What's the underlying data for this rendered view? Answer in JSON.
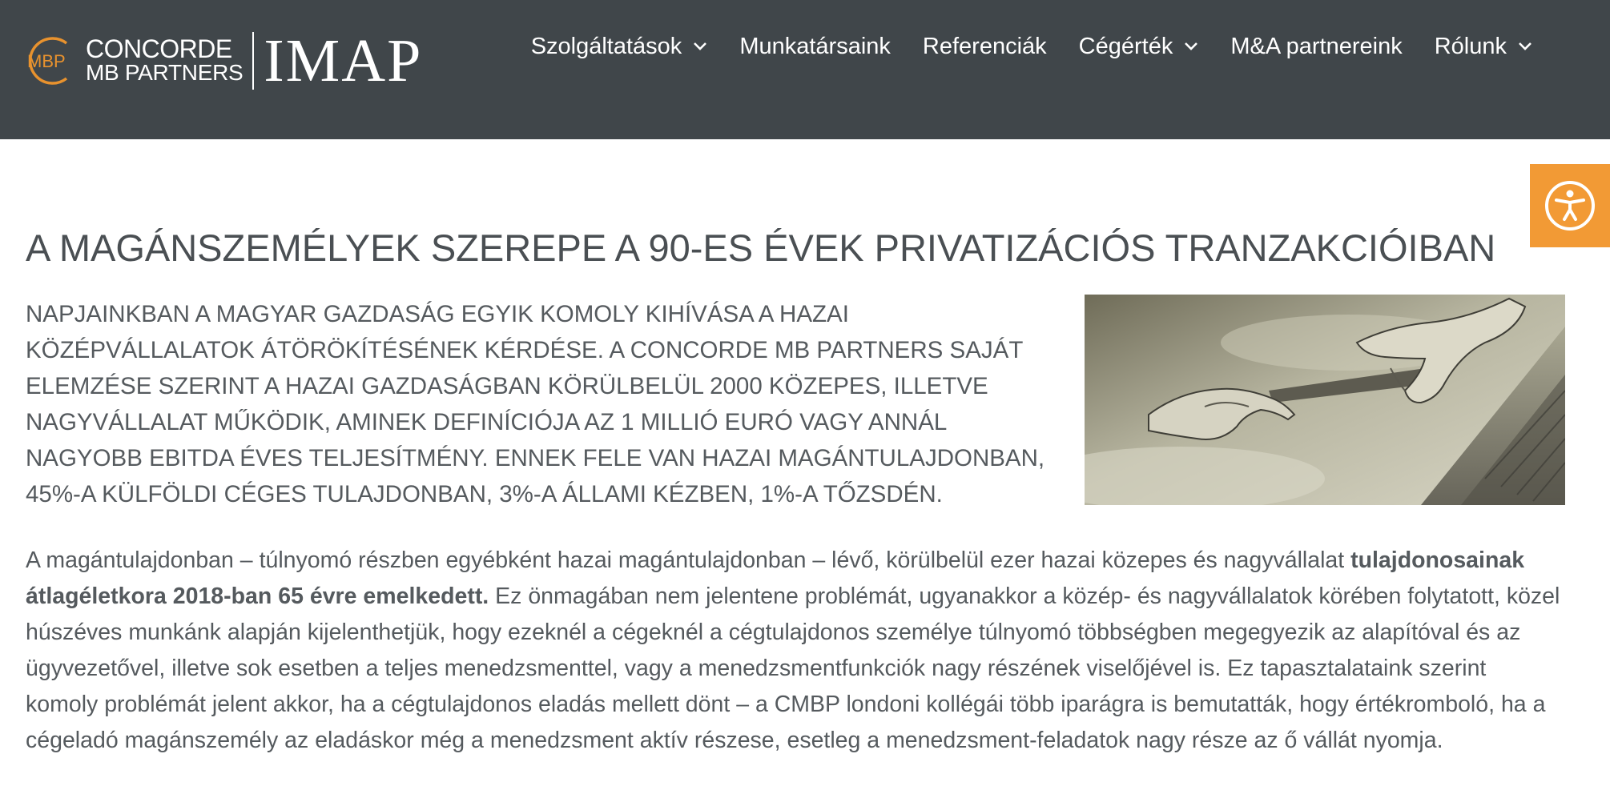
{
  "brand": {
    "mark": "MBP",
    "line1": "CONCORDE",
    "line2": "MB PARTNERS",
    "imap": "IMAP",
    "accent": "#e8922e"
  },
  "nav": {
    "items": [
      {
        "label": "Szolgáltatások",
        "has_dropdown": true
      },
      {
        "label": "Munkatársaink",
        "has_dropdown": false
      },
      {
        "label": "Referenciák",
        "has_dropdown": false
      },
      {
        "label": "Cégérték",
        "has_dropdown": true
      },
      {
        "label": "M&A partnereink",
        "has_dropdown": false
      },
      {
        "label": "Rólunk",
        "has_dropdown": true
      }
    ]
  },
  "accessibility": {
    "icon": "accessibility-icon",
    "color": "#f29a35"
  },
  "article": {
    "title": "A MAGÁNSZEMÉLYEK SZEREPE A 90-ES ÉVEK PRIVATIZÁCIÓS TRANZAKCIÓIBAN",
    "lead": "Napjainkban a magyar gazdaság egyik komoly kihívása a hazai középvállalatok átörökítésének kérdése. A Concorde MB Partners saját elemzése szerint a hazai gazdaságban körülbelül 2000 közepes, illetve nagyvállalat működik, aminek definíciója az 1 millió euró vagy annál nagyobb EBITDA éves teljesítmény. Ennek fele van hazai magántulajdonban, 45%-a külföldi céges tulajdonban, 3%-a állami kézben, 1%-a tőzsdén.",
    "image": "handshake-photo",
    "para_start": "A magántulajdonban – túlnyomó részben egyébként hazai magántulajdonban – lévő, körülbelül ezer hazai közepes és nagyvállalat ",
    "para_bold": "tulajdonosainak átlagéletkora 2018-ban 65 évre emelkedett.",
    "para_rest": " Ez önmagában nem jelentene problémát, ugyanakkor a közép- és nagyvállalatok körében folytatott, közel húszéves munkánk alapján kijelenthetjük, hogy ezeknél a cégeknél a cégtulajdonos személye túlnyomó többségben megegyezik az alapítóval és az ügyvezetővel, illetve sok esetben a teljes menedzsmenttel, vagy a menedzsmentfunkciók nagy részének viselőjével is. Ez tapasztalataink szerint komoly problémát jelent akkor, ha a cégtulajdonos eladás mellett dönt – a CMBP londoni kollégái több iparágra is bemutatták, hogy értékromboló, ha a cégeladó magánszemély az eladáskor még a menedzsment aktív részese, esetleg a menedzsment-feladatok nagy része az ő vállát nyomja."
  }
}
